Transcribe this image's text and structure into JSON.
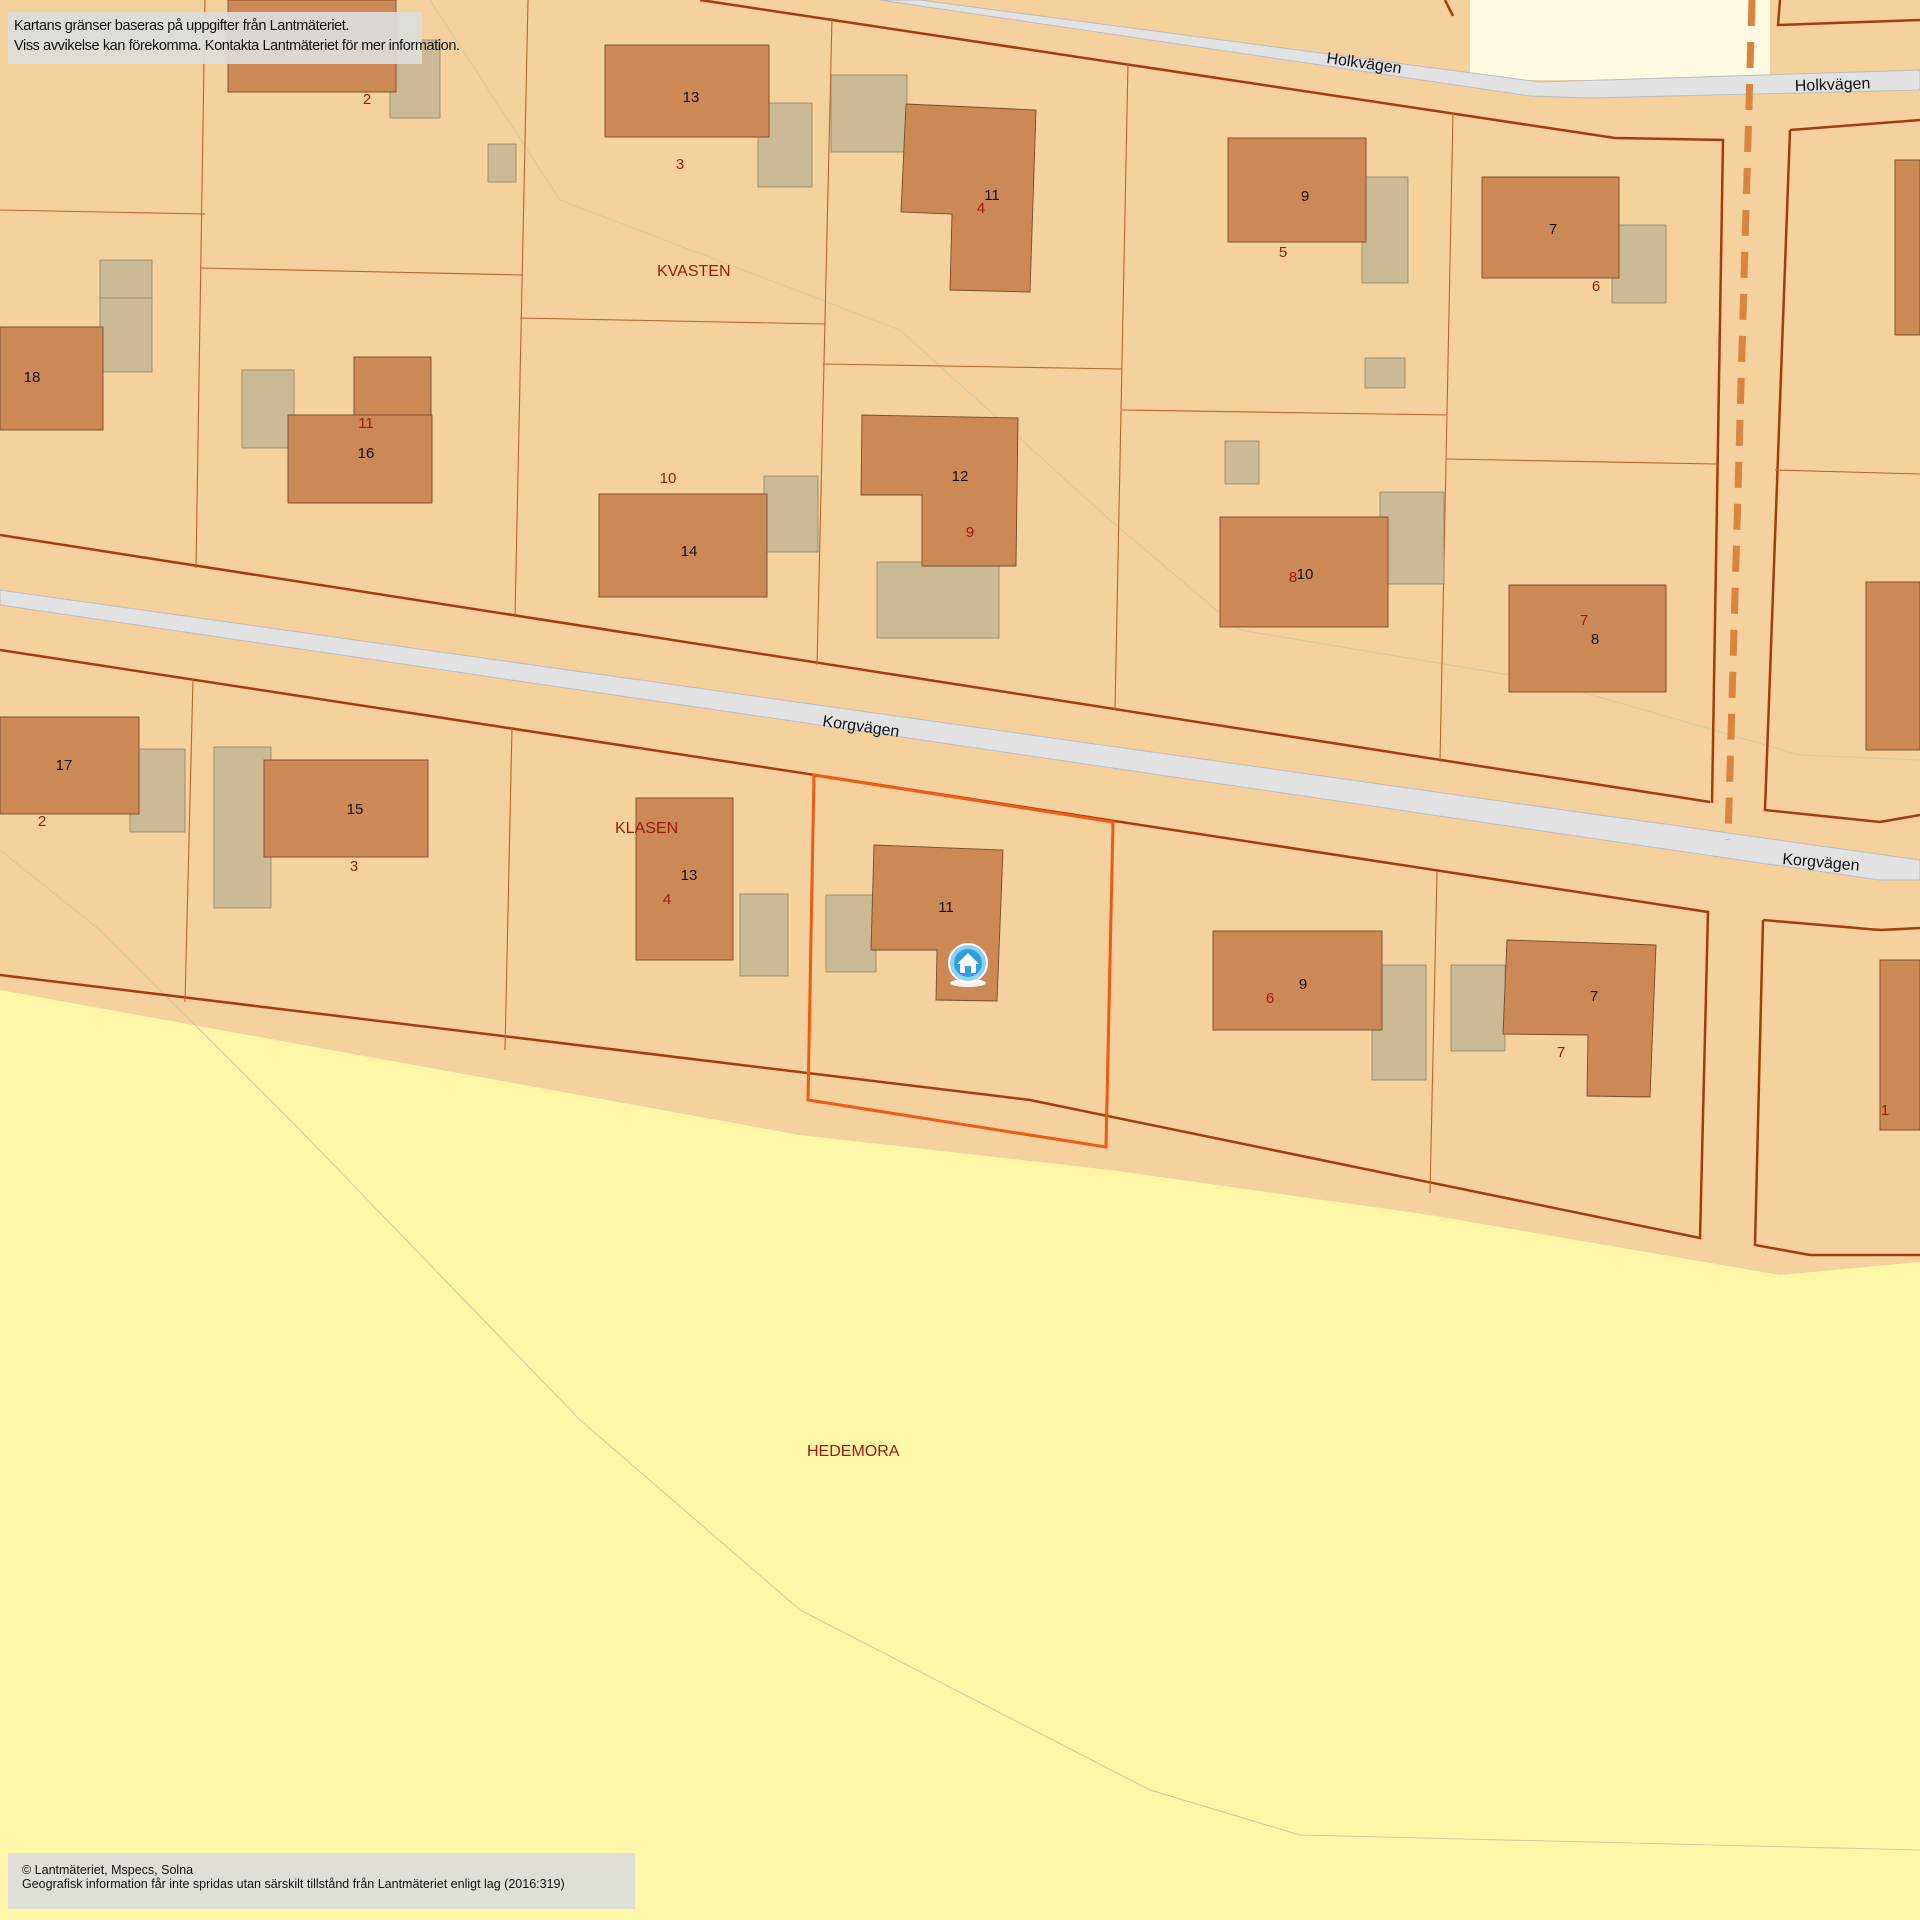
{
  "map": {
    "notice_top": {
      "line1": "Kartans gränser baseras på uppgifter från Lantmäteriet.",
      "line2": "Viss avvikelse kan förekomma. Kontakta Lantmäteriet för mer information."
    },
    "notice_bottom": {
      "line1": "© Lantmäteriet, Mspecs, Solna",
      "line2": "Geografisk information får inte spridas utan särskilt tillstånd från Lantmäteriet enligt lag (2016:319)"
    },
    "streets": {
      "holkvagen_1": "Holkvägen",
      "holkvagen_2": "Holkvägen",
      "korgvagen_1": "Korgvägen",
      "korgvagen_2": "Korgvägen"
    },
    "areas": {
      "kvasten": "KVASTEN",
      "klasen": "KLASEN",
      "hedemora": "HEDEMORA"
    },
    "house_numbers": {
      "n13_top": "13",
      "n11_top": "11",
      "n9_top": "9",
      "n7_top": "7",
      "n18": "18",
      "n16": "16",
      "n14": "14",
      "n12": "12",
      "n10": "10",
      "n8": "8",
      "n17": "17",
      "n15": "15",
      "n13_bottom": "13",
      "n11_bottom": "11",
      "n9_bottom": "9",
      "n7_bottom": "7"
    },
    "parcel_numbers": {
      "p2_top": "2",
      "p3_top": "3",
      "p4_top": "4",
      "p5": "5",
      "p6_top": "6",
      "p11": "11",
      "p10": "10",
      "p9": "9",
      "p8": "8",
      "p7_mid": "7",
      "p2_bottom": "2",
      "p3_bottom": "3",
      "p4_bottom": "4",
      "p6_bottom": "6",
      "p7_bottom": "7",
      "p1": "1"
    },
    "marker_icon": "home-marker-icon",
    "colors": {
      "land": "#f5d19e",
      "field": "#fff7a8",
      "building": "#cc8955",
      "outbuilding": "#cbba93",
      "road": "#e2e2e2",
      "boundary": "#a83b0c",
      "selected_boundary": "#f25a13",
      "label_red": "#9b1a0c"
    }
  }
}
